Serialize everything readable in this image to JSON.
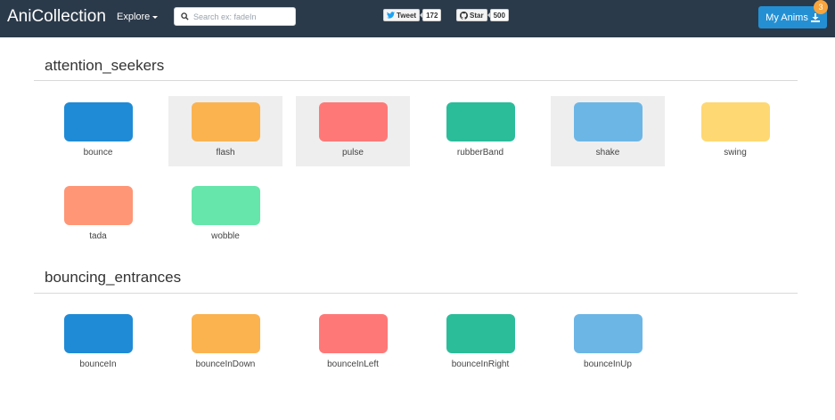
{
  "navbar": {
    "brand": "AniCollection",
    "explore_label": "Explore",
    "search_placeholder": "Search ex: fadeIn",
    "tweet_label": "Tweet",
    "tweet_count": "172",
    "star_label": "Star",
    "star_count": "500",
    "my_anims_label": "My Anims",
    "my_anims_badge": "3"
  },
  "colors": {
    "navbar_bg": "#2b3a4a",
    "blue": "#1f8bd6",
    "orange": "#fbb350",
    "red": "#ff7878",
    "teal": "#2bbd9a",
    "light_blue": "#6cb6e6",
    "yellow": "#fed873",
    "salmon": "#ff9676",
    "mint": "#66e6aa"
  },
  "sections": [
    {
      "title": "attention_seekers",
      "items": [
        {
          "label": "bounce",
          "color": "#1f8bd6",
          "highlighted": false
        },
        {
          "label": "flash",
          "color": "#fbb350",
          "highlighted": true
        },
        {
          "label": "pulse",
          "color": "#ff7878",
          "highlighted": true
        },
        {
          "label": "rubberBand",
          "color": "#2bbd9a",
          "highlighted": false
        },
        {
          "label": "shake",
          "color": "#6cb6e6",
          "highlighted": true
        },
        {
          "label": "swing",
          "color": "#fed873",
          "highlighted": false
        },
        {
          "label": "tada",
          "color": "#ff9676",
          "highlighted": false
        },
        {
          "label": "wobble",
          "color": "#66e6aa",
          "highlighted": false
        }
      ]
    },
    {
      "title": "bouncing_entrances",
      "items": [
        {
          "label": "bounceIn",
          "color": "#1f8bd6",
          "highlighted": false
        },
        {
          "label": "bounceInDown",
          "color": "#fbb350",
          "highlighted": false
        },
        {
          "label": "bounceInLeft",
          "color": "#ff7878",
          "highlighted": false
        },
        {
          "label": "bounceInRight",
          "color": "#2bbd9a",
          "highlighted": false
        },
        {
          "label": "bounceInUp",
          "color": "#6cb6e6",
          "highlighted": false
        }
      ]
    }
  ]
}
